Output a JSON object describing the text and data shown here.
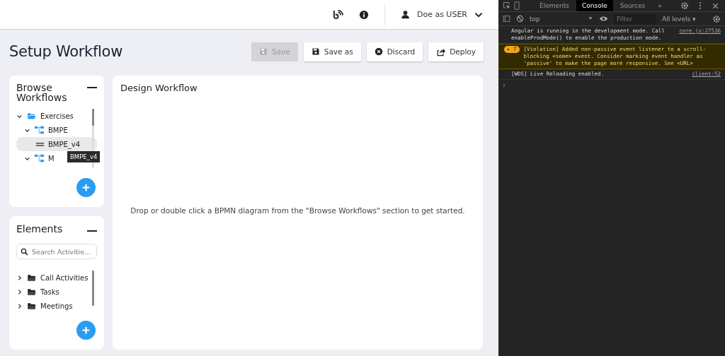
{
  "header": {
    "user": {
      "name": "Doe as USER"
    }
  },
  "page": {
    "title": "Setup Workflow",
    "actions": [
      {
        "label": "Save",
        "kind": "save",
        "disabled": true
      },
      {
        "label": "Save as",
        "kind": "save",
        "disabled": false
      },
      {
        "label": "Discard",
        "kind": "discard",
        "disabled": false
      },
      {
        "label": "Deploy",
        "kind": "deploy",
        "disabled": false
      }
    ]
  },
  "browse": {
    "title": "Browse Workflows",
    "tree": [
      {
        "label": "Exercises",
        "kind": "folder",
        "expanded": true,
        "selected": false,
        "children": [
          {
            "label": "BMPE",
            "kind": "diagram",
            "expanded": true,
            "selected": false,
            "children": [
              {
                "label": "BMPE_v4",
                "kind": "version",
                "selected": true
              }
            ]
          },
          {
            "label": "M",
            "kind": "diagram",
            "expanded": true,
            "selected": false
          }
        ]
      }
    ],
    "tooltip": "BMPE_v4"
  },
  "elements": {
    "title": "Elements",
    "search": {
      "placeholder": "Search Activitie..."
    },
    "tree": [
      {
        "label": "Call Activities",
        "kind": "folder",
        "expanded": false,
        "selected": false
      },
      {
        "label": "Tasks",
        "kind": "folder",
        "expanded": false,
        "selected": false
      },
      {
        "label": "Meetings",
        "kind": "folder",
        "expanded": false,
        "selected": false
      }
    ]
  },
  "design": {
    "title": "Design Workflow",
    "hint": "Drop or double click a BPMN diagram from the \"Browse Workflows\" section to get started."
  },
  "devtools": {
    "tabs": [
      {
        "label": "Elements",
        "selected": false
      },
      {
        "label": "Console",
        "selected": true
      },
      {
        "label": "Sources",
        "selected": false
      }
    ],
    "more": "»",
    "context": "top",
    "filter": {
      "placeholder": "Filter"
    },
    "levels": "All levels ▾",
    "messages": [
      {
        "kind": "info",
        "text": "Angular is running in the development mode. Call enableProdMode() to enable the production mode.",
        "source": "core.js:27536"
      },
      {
        "kind": "warning",
        "arrow": "▸",
        "count": "7",
        "text": "[Violation] Added non-passive event listener to a scroll-blocking <some> event. Consider marking event handler as 'passive' to make the page more responsive. See <URL>"
      },
      {
        "kind": "info",
        "text": "[WDS] Live Reloading enabled.",
        "source": "client:52"
      }
    ],
    "prompt": "›"
  }
}
